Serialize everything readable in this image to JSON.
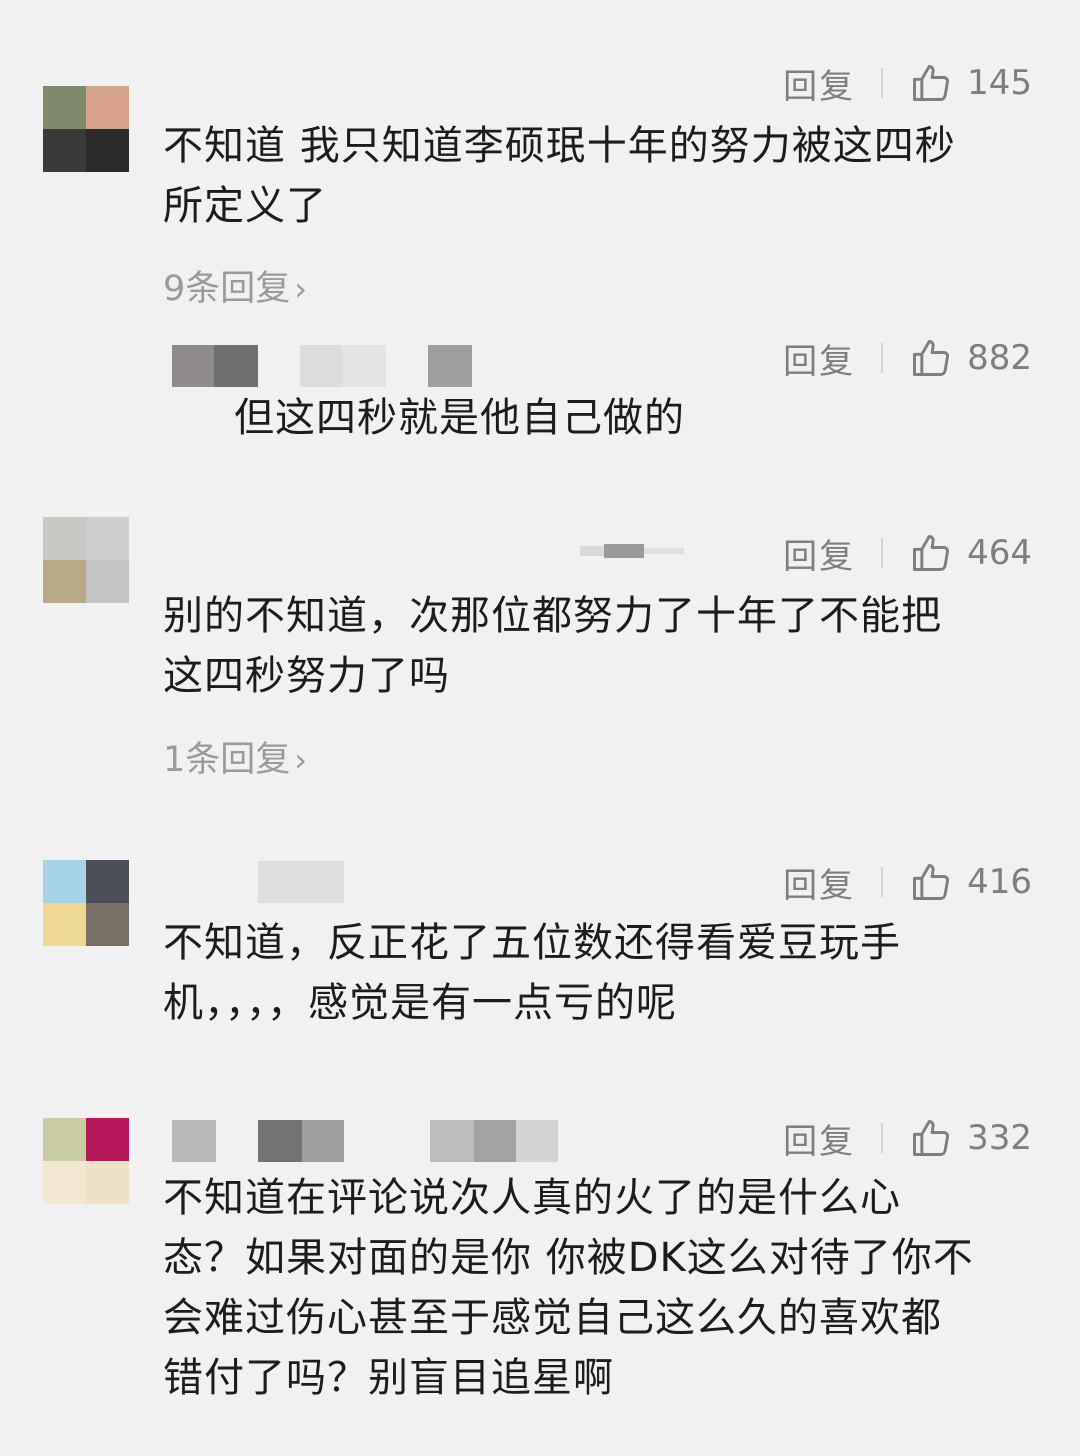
{
  "colors": {
    "background": "#f1f1f1",
    "text": "#1c1c1c",
    "meta": "#7e7e7e",
    "subreply": "#9a9a9a"
  },
  "icons": {
    "like": "thumbs-up-icon",
    "sub_reply_chevron": "chevron-right-icon"
  },
  "comments": [
    {
      "reply_label": "回复",
      "likes": "145",
      "lines": [
        "不知道 我只知道李硕珉十年的努力被这四秒",
        "所定义了"
      ],
      "sub_replies": "9条回复",
      "chevron": "›"
    },
    {
      "reply_label": "回复",
      "likes": "882",
      "lines": [
        "但这四秒就是他自己做的"
      ]
    },
    {
      "reply_label": "回复",
      "likes": "464",
      "lines": [
        "别的不知道，次那位都努力了十年了不能把",
        "这四秒努力了吗"
      ],
      "sub_replies": "1条回复",
      "chevron": "›"
    },
    {
      "reply_label": "回复",
      "likes": "416",
      "lines": [
        "不知道，反正花了五位数还得看爱豆玩手",
        "机，，，，感觉是有一点亏的呢"
      ]
    },
    {
      "reply_label": "回复",
      "likes": "332",
      "lines": [
        "不知道在评论说次人真的火了的是什么心",
        "态？如果对面的是你 你被DK这么对待了你不",
        "会难过伤心甚至于感觉自己这么久的喜欢都",
        "错付了吗？别盲目追星啊"
      ]
    }
  ]
}
